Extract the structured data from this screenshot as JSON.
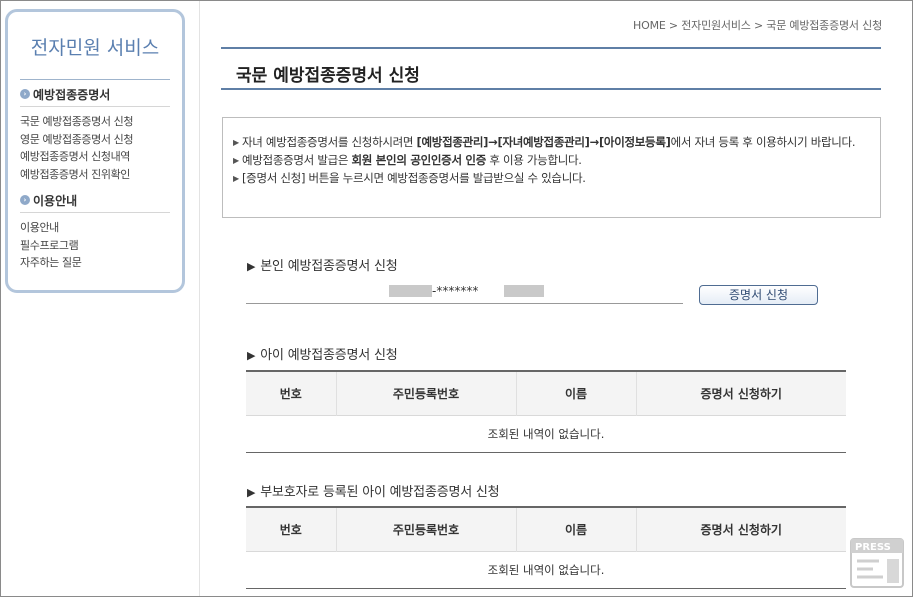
{
  "sidebar": {
    "title": "전자민원 서비스",
    "sections": [
      {
        "heading": "예방접종증명서",
        "items": [
          "국문 예방접종증명서 신청",
          "영문 예방접종증명서 신청",
          "예방접종증명서 신청내역",
          "예방접종증명서 진위확인"
        ]
      },
      {
        "heading": "이용안내",
        "items": [
          "이용안내",
          "필수프로그램",
          "자주하는 질문"
        ]
      }
    ]
  },
  "breadcrumb": "HOME > 전자민원서비스 > 국문 예방접종증명서 신청",
  "page_title": "국문 예방접종증명서 신청",
  "notice": {
    "item1_pre": "자녀 예방접종증명서를 신청하시려면 ",
    "item1_bold": "[예방접종관리]→[자녀예방접종관리]→[아이정보등록]",
    "item1_post": "에서 자녀 등록 후 이용하시기 바랍니다.",
    "item2_pre": "예방접종증명서 발급은 ",
    "item2_bold": "회원 본인의 공인인증서 인증",
    "item2_post": " 후 이용 가능합니다.",
    "item3": "[증명서 신청] 버튼을 누르시면 예방접종증명서를 발급받으실 수 있습니다."
  },
  "self_section": {
    "title": "본인 예방접종증명서 신청",
    "rrn_masked": "-*******",
    "button_label": "증명서 신청"
  },
  "child_section": {
    "title": "아이 예방접종증명서 신청",
    "columns": [
      "번호",
      "주민등록번호",
      "이름",
      "증명서 신청하기"
    ],
    "empty_message": "조회된 내역이 없습니다."
  },
  "guardian_section": {
    "title": "부보호자로 등록된 아이 예방접종증명서 신청",
    "columns": [
      "번호",
      "주민등록번호",
      "이름",
      "증명서 신청하기"
    ],
    "empty_message": "조회된 내역이 없습니다."
  },
  "watermark": "PRESS"
}
